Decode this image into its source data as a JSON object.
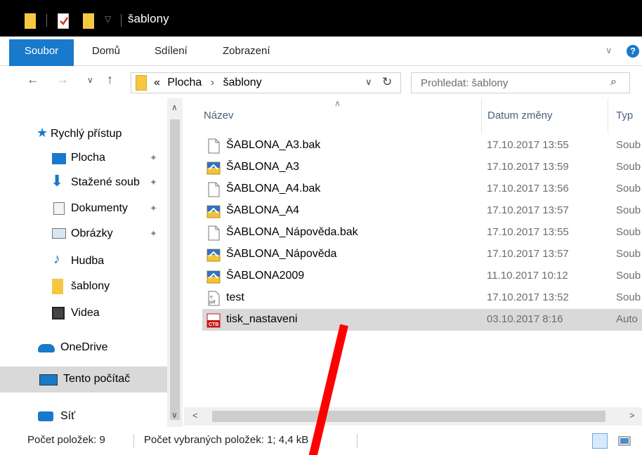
{
  "window": {
    "title": "šablony"
  },
  "ribbon": {
    "tabs": [
      "Soubor",
      "Domů",
      "Sdílení",
      "Zobrazení"
    ]
  },
  "address": {
    "prefix": "«",
    "path": [
      "Plocha",
      "šablony"
    ],
    "separator": "›",
    "search_placeholder": "Prohledat: šablony"
  },
  "nav": {
    "items": [
      {
        "label": "Rychlý přístup",
        "icon": "star-icon",
        "pinned": false
      },
      {
        "label": "Plocha",
        "icon": "desktop-icon",
        "pinned": true
      },
      {
        "label": "Stažené soub",
        "icon": "download-icon",
        "pinned": true
      },
      {
        "label": "Dokumenty",
        "icon": "documents-icon",
        "pinned": true
      },
      {
        "label": "Obrázky",
        "icon": "pictures-icon",
        "pinned": true
      },
      {
        "label": "Hudba",
        "icon": "music-icon",
        "pinned": false
      },
      {
        "label": "šablony",
        "icon": "folder-icon",
        "pinned": false
      },
      {
        "label": "Videa",
        "icon": "videos-icon",
        "pinned": false
      },
      {
        "label": "OneDrive",
        "icon": "cloud-icon",
        "pinned": false
      },
      {
        "label": "Tento počítač",
        "icon": "computer-icon",
        "pinned": false,
        "selected": true
      },
      {
        "label": "Síť",
        "icon": "network-icon",
        "pinned": false
      }
    ]
  },
  "columns": {
    "name": "Název",
    "date": "Datum změny",
    "type": "Typ"
  },
  "files": [
    {
      "name": "ŠABLONA_A3.bak",
      "date": "17.10.2017 13:55",
      "type": "Soub",
      "icon": "blank-file-icon"
    },
    {
      "name": "ŠABLONA_A3",
      "date": "17.10.2017 13:59",
      "type": "Soub",
      "icon": "template-file-icon"
    },
    {
      "name": "ŠABLONA_A4.bak",
      "date": "17.10.2017 13:56",
      "type": "Soub",
      "icon": "blank-file-icon"
    },
    {
      "name": "ŠABLONA_A4",
      "date": "17.10.2017 13:57",
      "type": "Soub",
      "icon": "template-file-icon"
    },
    {
      "name": "ŠABLONA_Nápověda.bak",
      "date": "17.10.2017 13:55",
      "type": "Soub",
      "icon": "blank-file-icon"
    },
    {
      "name": "ŠABLONA_Nápověda",
      "date": "17.10.2017 13:57",
      "type": "Soub",
      "icon": "template-file-icon"
    },
    {
      "name": "ŠABLONA2009",
      "date": "11.10.2017 10:12",
      "type": "Soub",
      "icon": "template-file-icon"
    },
    {
      "name": "test",
      "date": "17.10.2017 13:52",
      "type": "Soub",
      "icon": "pdf-file-icon"
    },
    {
      "name": "tisk_nastaveni",
      "date": "03.10.2017 8:16",
      "type": "Auto",
      "icon": "ctb-file-icon",
      "selected": true
    }
  ],
  "status": {
    "count": "Počet položek: 9",
    "selected": "Počet vybraných položek: 1; 4,4 kB"
  },
  "colors": {
    "accent": "#1979ca",
    "annotation": "#ff0000",
    "selection": "#d9d9d9"
  }
}
